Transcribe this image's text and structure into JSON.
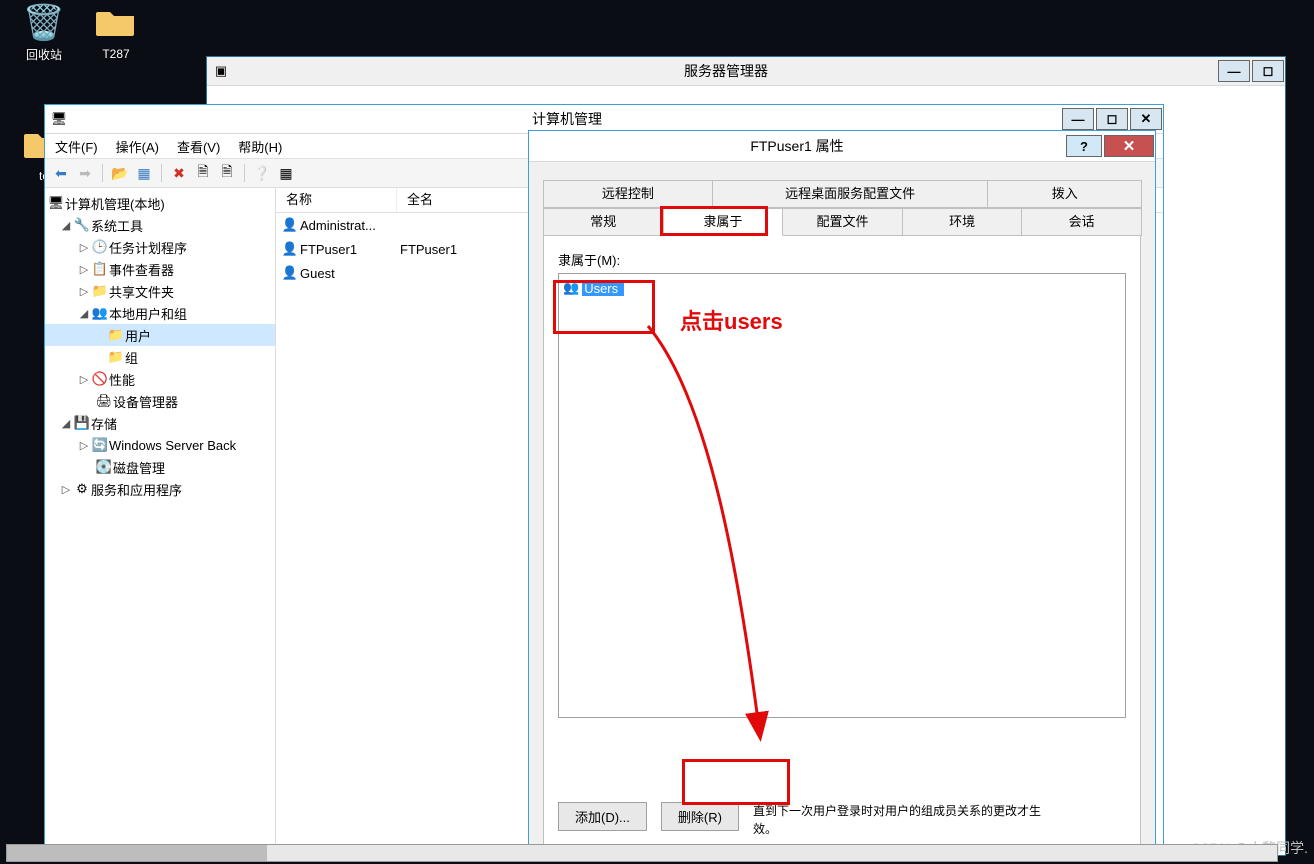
{
  "desktop": {
    "icons": [
      {
        "name": "recycle-bin",
        "label": "回收站"
      },
      {
        "name": "folder-t287",
        "label": "T287"
      },
      {
        "name": "folder-te",
        "label": "te"
      }
    ]
  },
  "server_manager": {
    "title": "服务器管理器"
  },
  "comp_mgmt": {
    "title": "计算机管理",
    "menu": {
      "file": "文件(F)",
      "action": "操作(A)",
      "view": "查看(V)",
      "help": "帮助(H)"
    },
    "tree": {
      "root": "计算机管理(本地)",
      "systools": "系统工具",
      "tasksched": "任务计划程序",
      "eventvwr": "事件查看器",
      "sharedf": "共享文件夹",
      "localusers": "本地用户和组",
      "users": "用户",
      "groups": "组",
      "perf": "性能",
      "devmgr": "设备管理器",
      "storage": "存储",
      "wsb": "Windows Server Back",
      "diskm": "磁盘管理",
      "svcapps": "服务和应用程序"
    },
    "list": {
      "col_name": "名称",
      "col_full": "全名",
      "rows": [
        {
          "name": "Administrat...",
          "full": ""
        },
        {
          "name": "FTPuser1",
          "full": "FTPuser1"
        },
        {
          "name": "Guest",
          "full": ""
        }
      ]
    }
  },
  "props": {
    "title": "FTPuser1 属性",
    "tabs_top": {
      "remote_ctrl": "远程控制",
      "rdp_profile": "远程桌面服务配置文件",
      "dialin": "拨入"
    },
    "tabs_bot": {
      "general": "常规",
      "memberof": "隶属于",
      "profile": "配置文件",
      "env": "环境",
      "session": "会话"
    },
    "memberof_label": "隶属于(M):",
    "group_item": "Users",
    "add_btn": "添加(D)...",
    "remove_btn": "删除(R)",
    "hint": "直到下一次用户登录时对用户的组成员关系的更改才生效。"
  },
  "annotations": {
    "click_users": "点击users"
  },
  "watermark": "CSDN @小黎同学."
}
